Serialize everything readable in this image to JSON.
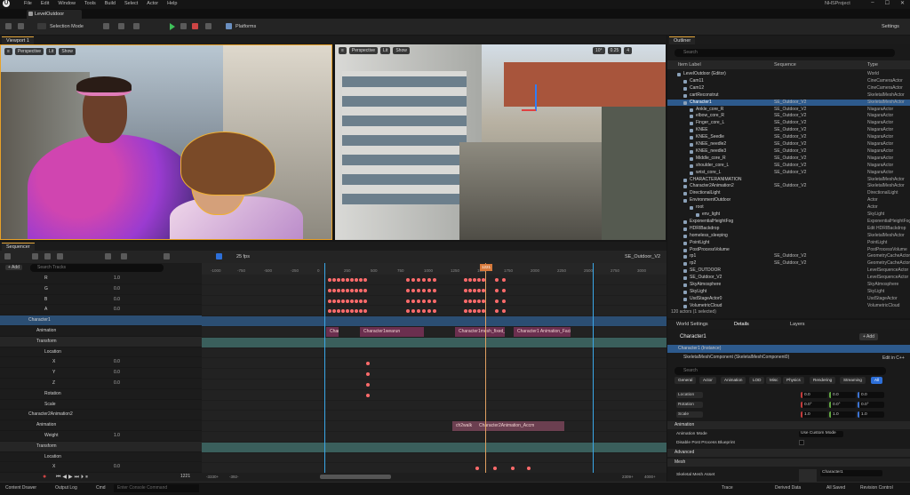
{
  "menu": {
    "items": [
      "File",
      "Edit",
      "Window",
      "Tools",
      "Build",
      "Select",
      "Actor",
      "Help"
    ],
    "project": "NHSProject"
  },
  "level_tab": "LevelOutdoor",
  "toolbar": {
    "selection_mode": "Selection Mode",
    "platforms": "Platforms",
    "settings": "Settings"
  },
  "viewport1": {
    "tab": "Viewport 1",
    "view": "Perspective",
    "lit": "Lit",
    "show": "Show"
  },
  "viewport2": {
    "view": "Perspective",
    "lit": "Lit",
    "show": "Show",
    "fov": "10°",
    "scale": "0.25",
    "speed": "4"
  },
  "outliner": {
    "tab": "Outliner",
    "search": "Search",
    "col_label": "Item Label",
    "col_seq": "Sequence",
    "col_type": "Type",
    "rows": [
      {
        "name": "LevelOutdoor (Editor)",
        "seq": "",
        "type": "World",
        "d": 1
      },
      {
        "name": "Cam11",
        "seq": "",
        "type": "CineCameraActor",
        "d": 2
      },
      {
        "name": "Cam12",
        "seq": "",
        "type": "CineCameraActor",
        "d": 2
      },
      {
        "name": "cartReconstrut",
        "seq": "",
        "type": "SkeletalMeshActor",
        "d": 2
      },
      {
        "name": "Character1",
        "seq": "SE_Outdoor_V2",
        "type": "SkeletalMeshActor",
        "d": 2,
        "sel": true
      },
      {
        "name": "Ankle_core_R",
        "seq": "SE_Outdoor_V2",
        "type": "NiagaraActor",
        "d": 3
      },
      {
        "name": "elbow_core_R",
        "seq": "SE_Outdoor_V2",
        "type": "NiagaraActor",
        "d": 3
      },
      {
        "name": "Finger_core_L",
        "seq": "SE_Outdoor_V2",
        "type": "NiagaraActor",
        "d": 3
      },
      {
        "name": "KNEE",
        "seq": "SE_Outdoor_V2",
        "type": "NiagaraActor",
        "d": 3
      },
      {
        "name": "KNEE_Seedle",
        "seq": "SE_Outdoor_V2",
        "type": "NiagaraActor",
        "d": 3
      },
      {
        "name": "KNEE_needle2",
        "seq": "SE_Outdoor_V2",
        "type": "NiagaraActor",
        "d": 3
      },
      {
        "name": "KNEE_needle3",
        "seq": "SE_Outdoor_V2",
        "type": "NiagaraActor",
        "d": 3
      },
      {
        "name": "Middle_core_R",
        "seq": "SE_Outdoor_V2",
        "type": "NiagaraActor",
        "d": 3
      },
      {
        "name": "shoulder_core_L",
        "seq": "SE_Outdoor_V2",
        "type": "NiagaraActor",
        "d": 3
      },
      {
        "name": "wrist_core_L",
        "seq": "SE_Outdoor_V2",
        "type": "NiagaraActor",
        "d": 3
      },
      {
        "name": "CHARACTERANIMATION",
        "seq": "",
        "type": "SkeletalMeshActor",
        "d": 2
      },
      {
        "name": "Character2Animation2",
        "seq": "SE_Outdoor_V2",
        "type": "SkeletalMeshActor",
        "d": 2
      },
      {
        "name": "DirectionalLight",
        "seq": "",
        "type": "DirectionalLight",
        "d": 2
      },
      {
        "name": "EnvironmentOutdoor",
        "seq": "",
        "type": "Actor",
        "d": 2
      },
      {
        "name": "root",
        "seq": "",
        "type": "Actor",
        "d": 3
      },
      {
        "name": "env_light",
        "seq": "",
        "type": "SkyLight",
        "d": 4
      },
      {
        "name": "ExponentialHeightFog",
        "seq": "",
        "type": "ExponentialHeightFog",
        "d": 2
      },
      {
        "name": "HDRIBackdrop",
        "seq": "",
        "type": "Edit HDRIBackdrop",
        "d": 2
      },
      {
        "name": "homeless_sleeping",
        "seq": "",
        "type": "SkeletalMeshActor",
        "d": 2
      },
      {
        "name": "PointLight",
        "seq": "",
        "type": "PointLight",
        "d": 2
      },
      {
        "name": "PostProcessVolume",
        "seq": "",
        "type": "PostProcessVolume",
        "d": 2
      },
      {
        "name": "rp1",
        "seq": "SE_Outdoor_V2",
        "type": "GeometryCacheActor",
        "d": 2
      },
      {
        "name": "rp2",
        "seq": "SE_Outdoor_V2",
        "type": "GeometryCacheActor",
        "d": 2
      },
      {
        "name": "SE_OUTDOOR",
        "seq": "",
        "type": "LevelSequenceActor",
        "d": 2
      },
      {
        "name": "SE_Outdoor_V2",
        "seq": "",
        "type": "LevelSequenceActor",
        "d": 2
      },
      {
        "name": "SkyAtmosphere",
        "seq": "",
        "type": "SkyAtmosphere",
        "d": 2
      },
      {
        "name": "SkyLight",
        "seq": "",
        "type": "SkyLight",
        "d": 2
      },
      {
        "name": "UsdStageActor0",
        "seq": "",
        "type": "UsdStageActor",
        "d": 2
      },
      {
        "name": "VolumetricCloud",
        "seq": "",
        "type": "VolumetricCloud",
        "d": 2
      }
    ],
    "footer": "120 actors (1 selected)"
  },
  "details": {
    "tabs": [
      "World Settings",
      "Details",
      "Layers"
    ],
    "actor": "Character1",
    "add": "+ Add",
    "instance": "Character1 (Instance)",
    "component": "SkeletalMeshComponent (SkeletalMeshComponent0)",
    "edit_cpp": "Edit in C++",
    "search": "Search",
    "categories": [
      "General",
      "Actor",
      "Animation",
      "LOD",
      "Misc",
      "Physics",
      "Rendering",
      "Streaming",
      "All"
    ],
    "location": {
      "label": "Location",
      "x": "0.0",
      "y": "0.0",
      "z": "0.0"
    },
    "rotation": {
      "label": "Rotation",
      "x": "0.0°",
      "y": "0.0°",
      "z": "0.0°"
    },
    "scale": {
      "label": "Scale",
      "x": "1.0",
      "y": "1.0",
      "z": "1.0"
    },
    "animation_section": "Animation",
    "animation_mode_label": "Animation Mode",
    "animation_mode_value": "Use Custom Mode",
    "disable_pp_label": "Disable Post Process Blueprint",
    "advanced_section": "Advanced",
    "mesh_section": "Mesh",
    "skeletal_mesh_label": "Skeletal Mesh Asset",
    "skeletal_mesh_value": "Character1"
  },
  "sequencer": {
    "tab": "Sequencer",
    "add": "+ Add",
    "search": "Search Tracks",
    "fps": "25 fps",
    "sequence_name": "SE_Outdoor_V2",
    "current_frame": "1221",
    "frame_display": "1221",
    "range_start": "-3330+",
    "range_start2": "-392-",
    "range_end": "2309+",
    "range_end2": "4000+",
    "ruler": [
      "-1000",
      "-750",
      "-500",
      "-250",
      "0",
      "250",
      "500",
      "750",
      "1000",
      "1250",
      "1500",
      "1750",
      "2000",
      "2250",
      "2500",
      "2750",
      "3000"
    ],
    "tracks": [
      {
        "label": "R",
        "value": "1.0",
        "d": 4
      },
      {
        "label": "G",
        "value": "0.0",
        "d": 4
      },
      {
        "label": "B",
        "value": "0.0",
        "d": 4
      },
      {
        "label": "A",
        "value": "0.0",
        "d": 4
      },
      {
        "label": "Character1",
        "value": "",
        "d": 2,
        "hl": true
      },
      {
        "label": "Animation",
        "value": "",
        "d": 3
      },
      {
        "label": "Transform",
        "value": "",
        "d": 3,
        "tr": true
      },
      {
        "label": "Location",
        "value": "",
        "d": 4
      },
      {
        "label": "X",
        "value": "0.0",
        "d": 5
      },
      {
        "label": "Y",
        "value": "0.0",
        "d": 5
      },
      {
        "label": "Z",
        "value": "0.0",
        "d": 5
      },
      {
        "label": "Rotation",
        "value": "",
        "d": 4
      },
      {
        "label": "Scale",
        "value": "",
        "d": 4
      },
      {
        "label": "Character2Animation2",
        "value": "",
        "d": 2
      },
      {
        "label": "Animation",
        "value": "",
        "d": 3
      },
      {
        "label": "Weight",
        "value": "1.0",
        "d": 4
      },
      {
        "label": "Transform",
        "value": "",
        "d": 3,
        "tr": true
      },
      {
        "label": "Location",
        "value": "",
        "d": 4
      },
      {
        "label": "X",
        "value": "0.0",
        "d": 5
      }
    ],
    "sections": [
      {
        "label": "Character1",
        "row": 5
      },
      {
        "label": "Character1wearun",
        "row": 5
      },
      {
        "label": "Character1mesh_fixed_a",
        "row": 5
      },
      {
        "label": "Character1 Animation_Facial_A",
        "row": 5
      },
      {
        "label": "ch2walk",
        "row": 14
      },
      {
        "label": "Character2Animation_Accm",
        "row": 14
      }
    ]
  },
  "statusbar": {
    "content_drawer": "Content Drawer",
    "output_log": "Output Log",
    "cmd": "Cmd",
    "console_placeholder": "Enter Console Command",
    "trace": "Trace",
    "derived_data": "Derived Data",
    "all_saved": "All Saved",
    "revision_control": "Revision Control"
  }
}
